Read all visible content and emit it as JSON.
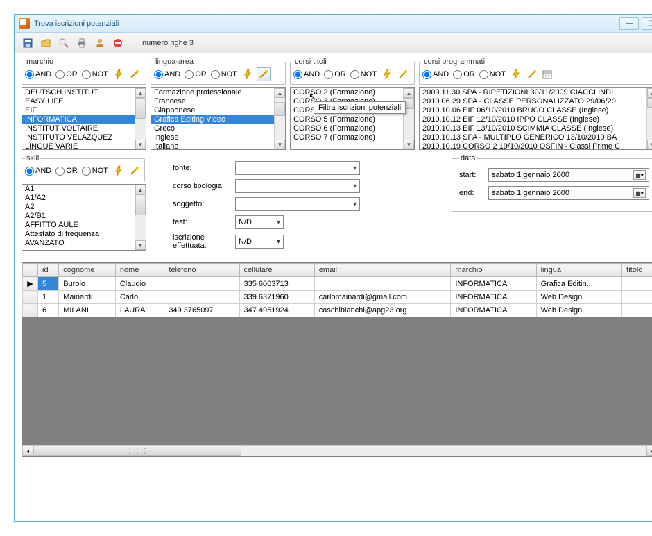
{
  "window": {
    "title": "Trova iscrizioni potenziali"
  },
  "toolbar": {
    "row_count_label": "numero righe 3"
  },
  "logic": {
    "and": "AND",
    "or": "OR",
    "not": "NOT"
  },
  "filters": {
    "marchio": {
      "label": "marchio"
    },
    "lingua": {
      "label": "lingua-area"
    },
    "corsi_titoli": {
      "label": "corsi titoli"
    },
    "corsi_prog": {
      "label": "corsi programmati"
    },
    "skill": {
      "label": "skill"
    }
  },
  "tooltip": "Filtra iscrizioni potenziali",
  "lists": {
    "marchio": [
      "DEUTSCH INSTITUT",
      "EASY LIFE",
      "EIF",
      "INFORMATICA",
      "INSTITUT VOLTAIRE",
      "INSTITUTO VELAZQUEZ",
      "LINGUE VARIE"
    ],
    "marchio_sel": 3,
    "lingua": [
      "Formazione professionale",
      "Francese",
      "Giapponese",
      "Grafica Editing Video",
      "Greco",
      "Inglese",
      "Italiano"
    ],
    "lingua_sel": 3,
    "corsi_titoli": [
      "CORSO 2 (Formazione)",
      "CORSO 3 (Formazione)",
      "CORSO 4 (Formazione)",
      "CORSO 5 (Formazione)",
      "CORSO 6 (Formazione)",
      "CORSO 7 (Formazione)"
    ],
    "corsi_prog": [
      "2009.11.30 SPA - RIPETIZIONI 30/11/2009 CIACCI INDI",
      "2010.06.29 SPA - CLASSE PERSONALIZZATO 29/06/20",
      "2010.10.06 EIF  06/10/2010 BRUCO CLASSE (Inglese)",
      "2010.10.12 EIF  12/10/2010 IPPO CLASSE (Inglese)",
      "2010.10.13 EIF  13/10/2010 SCIMMIA CLASSE (Inglese)",
      "2010.10.13 SPA - MULTIPLO GENERICO 13/10/2010 BA",
      "2010.10.19 CORSO 2 19/10/2010 OSFIN - Classi Prime C"
    ],
    "skill": [
      "A1",
      "A1/A2",
      "A2",
      "A2/B1",
      "AFFITTO AULE",
      "Attestato di frequenza",
      "AVANZATO"
    ]
  },
  "form": {
    "fonte": "fonte:",
    "corso_tipologia": "corso tipologia:",
    "soggetto": "soggetto:",
    "test": "test:",
    "test_value": "N/D",
    "iscrizione": "iscrizione effettuata:",
    "iscrizione_value": "N/D"
  },
  "data_fs": {
    "legend": "data",
    "start": "start:",
    "end": "end:",
    "date_value": "sabato    1  gennaio   2000"
  },
  "grid": {
    "headers": [
      "id",
      "cognome",
      "nome",
      "telefono",
      "cellulare",
      "email",
      "marchio",
      "lingua",
      "titolo"
    ],
    "rows": [
      {
        "id": "5",
        "cognome": "Burolo",
        "nome": "Claudio",
        "telefono": "",
        "cellulare": "335 6003713",
        "email": "",
        "marchio": "INFORMATICA",
        "lingua": "Grafica Editin...",
        "titolo": "",
        "sel": true
      },
      {
        "id": "1",
        "cognome": "Mainardi",
        "nome": "Carlo",
        "telefono": "",
        "cellulare": "339 6371960",
        "email": "carlomainardi@gmail.com",
        "marchio": "INFORMATICA",
        "lingua": "Web Design",
        "titolo": ""
      },
      {
        "id": "6",
        "cognome": "MILANI",
        "nome": "LAURA",
        "telefono": "349 3765097",
        "cellulare": "347 4951924",
        "email": "caschibianchi@apg23.org",
        "marchio": "INFORMATICA",
        "lingua": "Web Design",
        "titolo": ""
      }
    ]
  }
}
